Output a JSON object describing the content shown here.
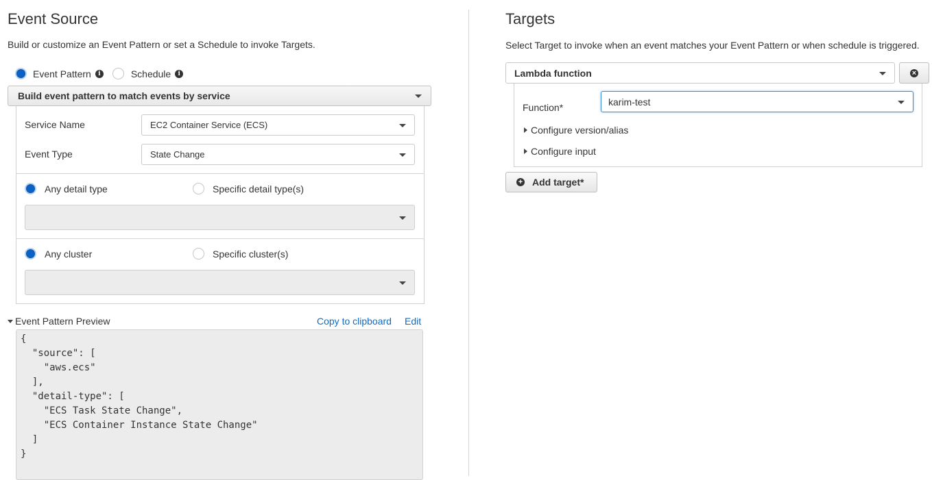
{
  "event_source": {
    "title": "Event Source",
    "description": "Build or customize an Event Pattern or set a Schedule to invoke Targets.",
    "mode_options": [
      {
        "label": "Event Pattern",
        "selected": true,
        "icon": "info-icon"
      },
      {
        "label": "Schedule",
        "selected": false,
        "icon": "info-icon"
      }
    ],
    "pattern_builder": {
      "selected": "Build event pattern to match events by service"
    },
    "fields": {
      "service_name": {
        "label": "Service Name",
        "value": "EC2 Container Service (ECS)"
      },
      "event_type": {
        "label": "Event Type",
        "value": "State Change"
      }
    },
    "detail_type": {
      "any_label": "Any detail type",
      "specific_label": "Specific detail type(s)",
      "selected": "any",
      "select_value": ""
    },
    "cluster": {
      "any_label": "Any cluster",
      "specific_label": "Specific cluster(s)",
      "selected": "any",
      "select_value": ""
    },
    "preview": {
      "label": "Event Pattern Preview",
      "copy_link": "Copy to clipboard",
      "edit_link": "Edit",
      "code": "{\n  \"source\": [\n    \"aws.ecs\"\n  ],\n  \"detail-type\": [\n    \"ECS Task State Change\",\n    \"ECS Container Instance State Change\"\n  ]\n}"
    }
  },
  "targets": {
    "title": "Targets",
    "description": "Select Target to invoke when an event matches your Event Pattern or when schedule is triggered.",
    "target_type": "Lambda function",
    "remove_icon": "close-circle-icon",
    "function_label": "Function*",
    "function_value": "karim-test",
    "configure_version": "Configure version/alias",
    "configure_input": "Configure input",
    "add_target_label": "Add target*"
  },
  "colors": {
    "accent": "#0b62c4",
    "link": "#0b6bc4"
  }
}
